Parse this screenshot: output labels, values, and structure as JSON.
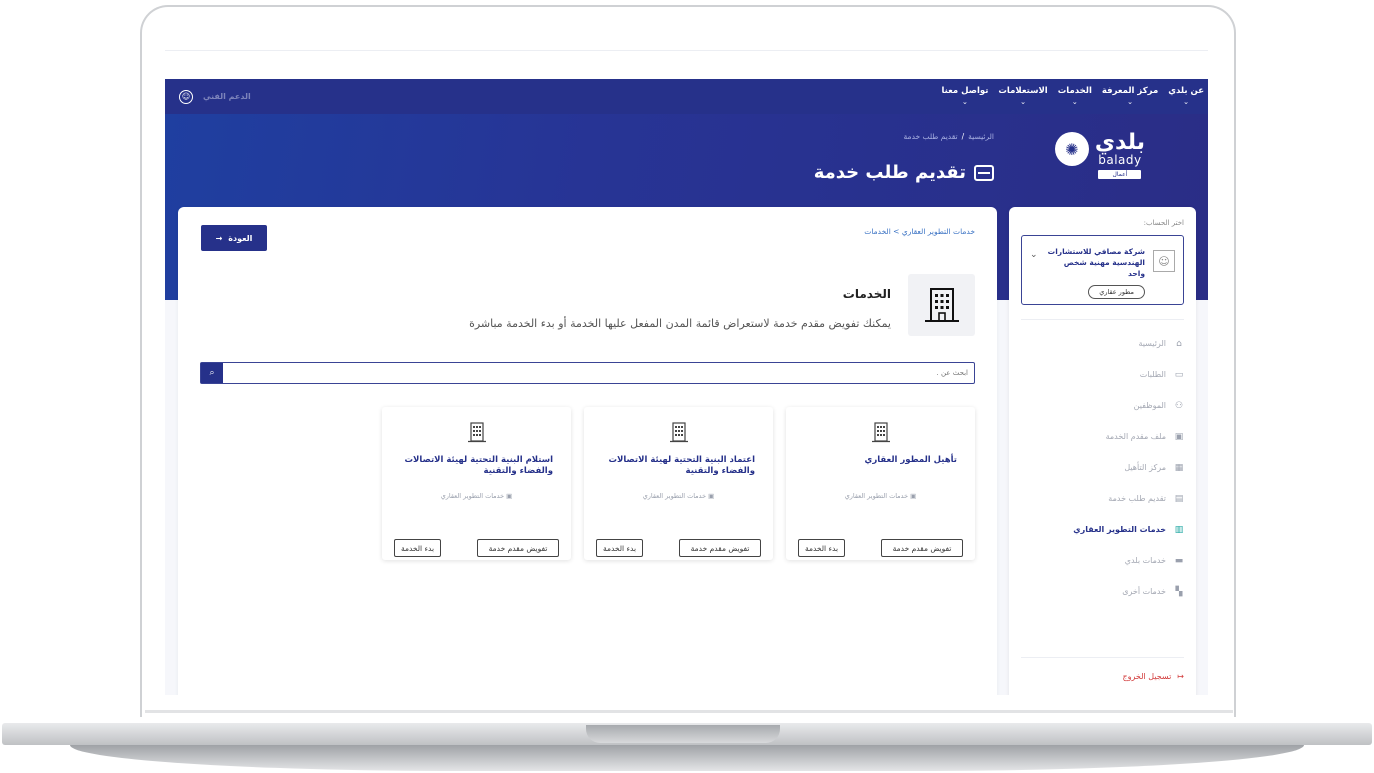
{
  "nav": {
    "items": [
      "عن بلدي",
      "مركز المعرفة",
      "الخدمات",
      "الاستعلامات",
      "تواصل معنا"
    ],
    "support_label": "الدعم الفني"
  },
  "logo": {
    "arabic": "بلدي",
    "english": "balady",
    "tag": "أعمال"
  },
  "hero": {
    "breadcrumb_home": "الرئيسية",
    "breadcrumb_current": "تقديم طلب خدمة",
    "title": "تقديم طلب خدمة"
  },
  "sidebar": {
    "account_label": "اختر الحساب:",
    "account_name": "شركة مصافي للاستشارات الهندسية مهنية شخص واحد",
    "account_badge": "مطور عقاري",
    "items": [
      {
        "label": "الرئيسية",
        "icon": "home-icon"
      },
      {
        "label": "الطلبات",
        "icon": "inbox-icon"
      },
      {
        "label": "الموظفين",
        "icon": "users-icon"
      },
      {
        "label": "ملف مقدم الخدمة",
        "icon": "briefcase-icon"
      },
      {
        "label": "مركز التأهيل",
        "icon": "grid-icon"
      },
      {
        "label": "تقديم طلب خدمة",
        "icon": "form-icon"
      },
      {
        "label": "خدمات التطوير العقاري",
        "icon": "buildings-icon",
        "active": true
      },
      {
        "label": "خدمات بلدي",
        "icon": "folder-icon"
      },
      {
        "label": "خدمات أخرى",
        "icon": "apps-icon"
      }
    ],
    "logout": "تسجيل الخروج"
  },
  "main": {
    "breadcrumb": "خدمات التطوير العقاري > الخدمات",
    "back_label": "العودة",
    "title": "الخدمات",
    "description": "يمكنك تفويض مقدم خدمة لاستعراض قائمة المدن المفعل عليها الخدمة أو بدء الخدمة مباشرة",
    "search_placeholder": "ابحث عن .",
    "cards": [
      {
        "title": "تأهيل المطور العقاري",
        "category": "خدمات التطوير العقاري",
        "delegate": "تفويض مقدم خدمة",
        "start": "بدء الخدمة"
      },
      {
        "title": "اعتماد البنية التحتية لهيئة الاتصالات والفضاء والتقنية",
        "category": "خدمات التطوير العقاري",
        "delegate": "تفويض مقدم خدمة",
        "start": "بدء الخدمة"
      },
      {
        "title": "استلام البنية التحتية لهيئة الاتصالات والفضاء والتقنية",
        "category": "خدمات التطوير العقاري",
        "delegate": "تفويض مقدم خدمة",
        "start": "بدء الخدمة"
      }
    ]
  },
  "colors": {
    "primary": "#26318a",
    "accent": "#1ba5a0",
    "link": "#3b73c4",
    "danger": "#d23a3a"
  }
}
